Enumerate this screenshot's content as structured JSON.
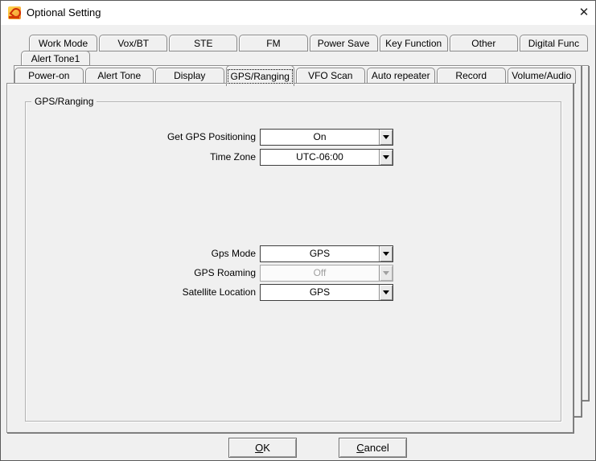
{
  "window": {
    "title": "Optional Setting",
    "close_glyph": "✕"
  },
  "icons": {
    "app": "radio-app-icon",
    "close": "close-icon",
    "combo_arrow": "chevron-down-icon"
  },
  "tabs": {
    "row1": [
      "Work Mode",
      "Vox/BT",
      "STE",
      "FM",
      "Power Save",
      "Key Function",
      "Other",
      "Digital Func"
    ],
    "row2": [
      "Alert Tone1"
    ],
    "row3": [
      "Power-on",
      "Alert Tone",
      "Display",
      "GPS/Ranging",
      "VFO Scan",
      "Auto repeater",
      "Record",
      "Volume/Audio"
    ],
    "selected": "GPS/Ranging"
  },
  "group": {
    "title": "GPS/Ranging"
  },
  "fields": [
    {
      "label": "Get GPS Positioning",
      "value": "On",
      "disabled": false
    },
    {
      "label": "Time Zone",
      "value": "UTC-06:00",
      "disabled": false
    },
    {
      "label": "Gps Mode",
      "value": "GPS",
      "disabled": false
    },
    {
      "label": "GPS Roaming",
      "value": "Off",
      "disabled": true
    },
    {
      "label": "Satellite Location",
      "value": "GPS",
      "disabled": false
    }
  ],
  "buttons": {
    "ok": "OK",
    "cancel": "Cancel"
  }
}
